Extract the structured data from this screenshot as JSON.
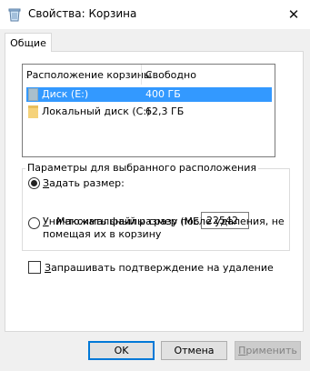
{
  "window": {
    "title": "Свойства: Корзина",
    "close_glyph": "✕"
  },
  "tabs": [
    {
      "label": "Общие",
      "selected": true
    }
  ],
  "locations": {
    "columns": [
      "Расположение корзины",
      "Свободно"
    ],
    "rows": [
      {
        "name": "Диск (E:)",
        "free": "400 ГБ",
        "selected": true,
        "icon": "drive-icon"
      },
      {
        "name": "Локальный диск (C:)",
        "free": "62,3 ГБ",
        "selected": false,
        "icon": "folder-icon"
      }
    ]
  },
  "settings": {
    "group_label": "Параметры для выбранного расположения",
    "custom_size": {
      "key": "З",
      "rest": "адать размер:",
      "selected": true,
      "max_size_label": "Максимальный размер (МБ):",
      "max_size_value": "22542"
    },
    "delete_immediately": {
      "key": "У",
      "rest_line1": "ничтожать файлы сразу после удаления, не",
      "line2": "помещая их в корзину",
      "selected": false
    }
  },
  "confirm_delete": {
    "key": "З",
    "rest": "апрашивать подтверждение на удаление",
    "checked": false
  },
  "buttons": {
    "ok": "OK",
    "cancel": "Отмена",
    "apply_key": "П",
    "apply_rest": "рименить"
  },
  "colors": {
    "selection": "#3399ff",
    "default_button_border": "#0078d7"
  }
}
